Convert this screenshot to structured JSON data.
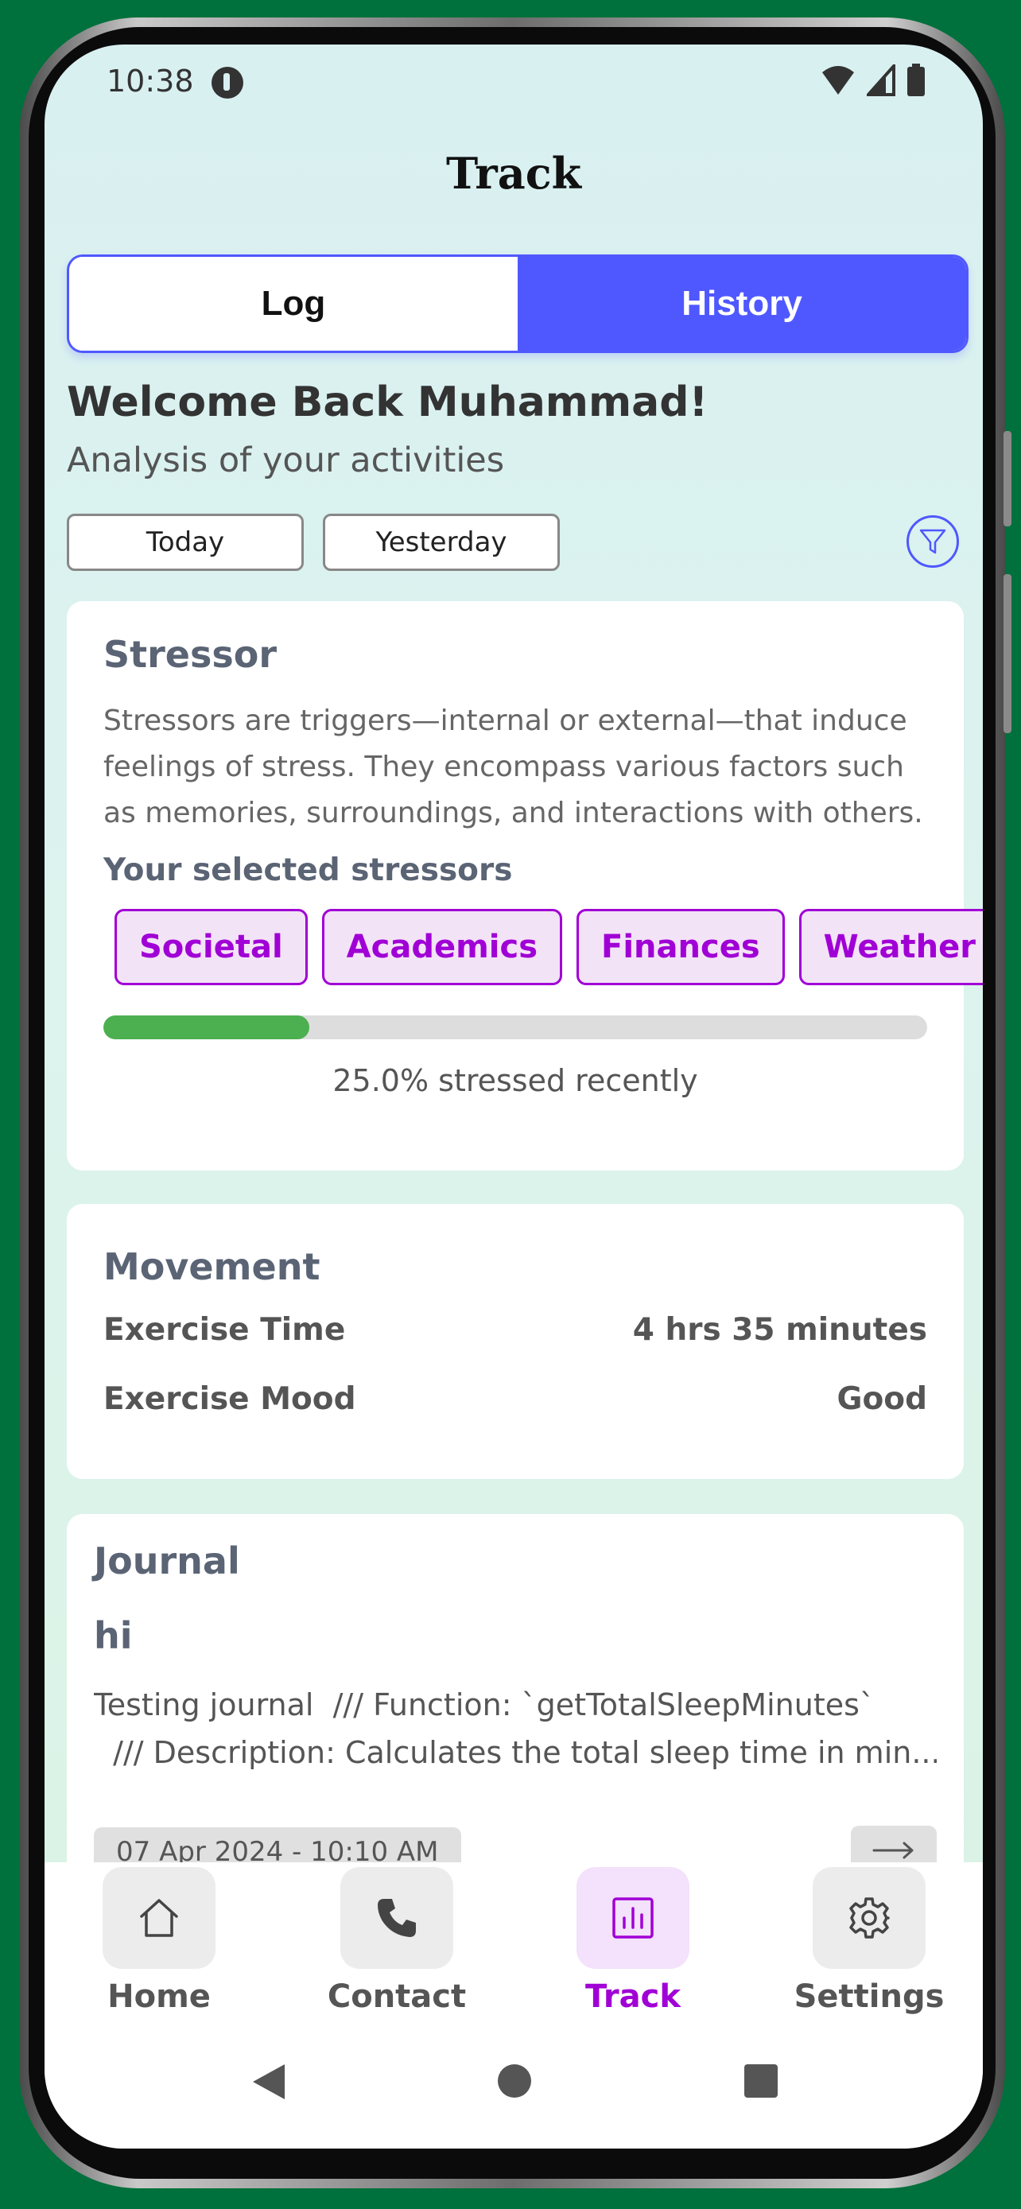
{
  "status_bar": {
    "time": "10:38"
  },
  "header": {
    "title": "Track"
  },
  "tabs": {
    "log_label": "Log",
    "history_label": "History",
    "active": "History"
  },
  "welcome": {
    "heading": "Welcome Back Muhammad!",
    "subtitle": "Analysis of your activities"
  },
  "date_filters": {
    "today_label": "Today",
    "yesterday_label": "Yesterday"
  },
  "stressor_card": {
    "title": "Stressor",
    "description": "Stressors are triggers—internal or external—that induce feelings of stress. They encompass various factors such as memories, surroundings, and interactions with others.",
    "selected_heading": "Your selected stressors",
    "stressors": [
      "Societal",
      "Academics",
      "Finances",
      "Weather"
    ],
    "stress_level_percent": 25.0,
    "progress_text": "25.0% stressed recently"
  },
  "movement_card": {
    "title": "Movement",
    "exercise_time_label": "Exercise Time",
    "exercise_time_value": "4 hrs 35 minutes",
    "exercise_mood_label": "Exercise Mood",
    "exercise_mood_value": "Good"
  },
  "journal_card": {
    "title": "Journal",
    "entry_title": "hi",
    "entry_line1": "Testing journal  /// Function: `getTotalSleepMinutes`",
    "entry_line2": "  /// Description: Calculates the total sleep time in min...",
    "entry_date": "07 Apr 2024 - 10:10 AM"
  },
  "bottom_nav": {
    "home_label": "Home",
    "contact_label": "Contact",
    "track_label": "Track",
    "settings_label": "Settings",
    "active": "Track"
  },
  "colors": {
    "accent": "#4F58FF",
    "chip_purple": "#A000D5",
    "progress_green": "#4CAF50",
    "frame_green": "#00703C"
  },
  "icons": [
    "app-notification-icon",
    "wifi-icon",
    "signal-icon",
    "battery-icon",
    "filter-icon",
    "arrow-right-icon",
    "home-icon",
    "phone-icon",
    "chart-icon",
    "gear-icon",
    "back-icon",
    "home-circle-icon",
    "recents-icon"
  ]
}
